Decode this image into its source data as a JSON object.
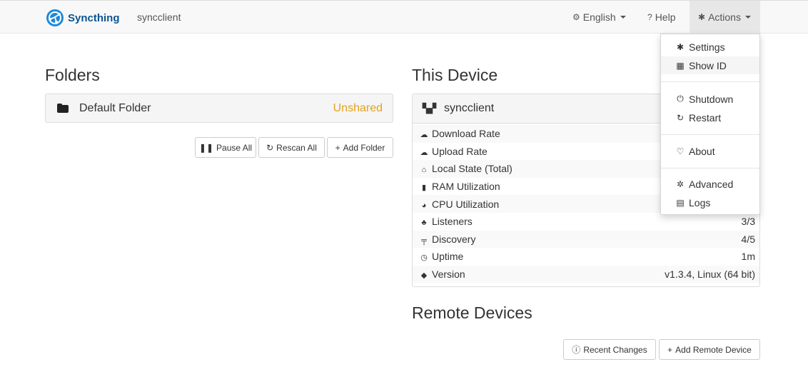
{
  "navbar": {
    "brand": "Syncthing",
    "device_name": "syncclient",
    "language": {
      "glyph": "⚙",
      "label": "English"
    },
    "help": {
      "glyph": "?",
      "label": "Help"
    },
    "actions": {
      "glyph": "✱",
      "label": "Actions"
    }
  },
  "folders": {
    "heading": "Folders",
    "items": [
      {
        "name": "Default Folder",
        "status": "Unshared",
        "status_color": "#e0a320"
      }
    ],
    "buttons": {
      "pause_all": "Pause All",
      "rescan_all": "Rescan All",
      "add_folder": "Add Folder"
    }
  },
  "this_device": {
    "heading": "This Device",
    "name": "syncclient",
    "stats": [
      {
        "label": "Download Rate",
        "value": "",
        "icon": "cloud-download-icon"
      },
      {
        "label": "Upload Rate",
        "value": "",
        "icon": "cloud-upload-icon"
      },
      {
        "label": "Local State (Total)",
        "value": "",
        "icon": "home-icon"
      },
      {
        "label": "RAM Utilization",
        "value": "",
        "icon": "memory-icon"
      },
      {
        "label": "CPU Utilization",
        "value": "",
        "icon": "dashboard-icon"
      },
      {
        "label": "Listeners",
        "value": "3/3",
        "icon": "sitemap-icon"
      },
      {
        "label": "Discovery",
        "value": "4/5",
        "icon": "signpost-icon"
      },
      {
        "label": "Uptime",
        "value": "1m",
        "icon": "clock-icon"
      },
      {
        "label": "Version",
        "value": "v1.3.4, Linux (64 bit)",
        "icon": "tag-icon"
      }
    ]
  },
  "remote_devices": {
    "heading": "Remote Devices",
    "buttons": {
      "recent_changes": "Recent Changes",
      "add_remote_device": "Add Remote Device"
    }
  },
  "actions_menu": {
    "items": [
      {
        "label": "Settings",
        "icon": "cog-icon"
      },
      {
        "label": "Show ID",
        "icon": "qrcode-icon"
      },
      {
        "label": "Shutdown",
        "icon": "power-icon"
      },
      {
        "label": "Restart",
        "icon": "refresh-icon"
      },
      {
        "label": "About",
        "icon": "heart-icon"
      },
      {
        "label": "Advanced",
        "icon": "cogs-icon"
      },
      {
        "label": "Logs",
        "icon": "file-icon"
      }
    ]
  },
  "colors": {
    "brand": "#0c5593",
    "unshared": "#e0a320",
    "listeners_ok": "#3cb34a"
  }
}
